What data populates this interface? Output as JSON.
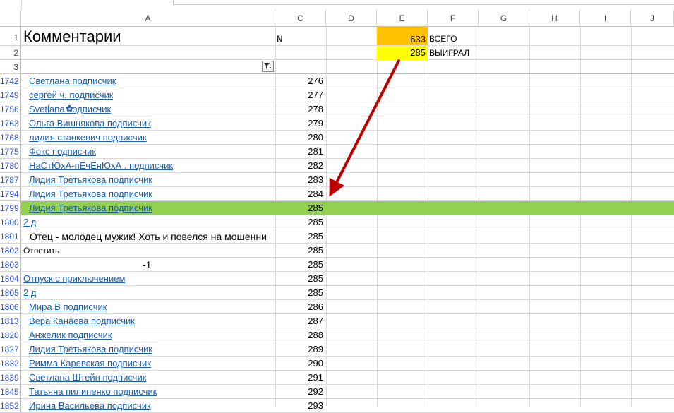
{
  "columns": [
    "A",
    "C",
    "D",
    "E",
    "F",
    "G",
    "H",
    "I",
    "J"
  ],
  "header": {
    "title": "Комментарии",
    "n_label": "N",
    "total_value": "633",
    "total_label": "ВСЕГО",
    "won_value": "285",
    "won_label": "ВЫИГРАЛ"
  },
  "header_rows": [
    "1",
    "2",
    "3"
  ],
  "rows": [
    {
      "num": "1742",
      "a": "Светлана подписчик",
      "c": "276",
      "link": true
    },
    {
      "num": "1749",
      "a": "сергей ч. подписчик",
      "c": "277",
      "link": true
    },
    {
      "num": "1756",
      "a": "Svetlana   подписчик",
      "c": "278",
      "link": true
    },
    {
      "num": "1763",
      "a": "Ольга Вишнякова подписчик",
      "c": "279",
      "link": true
    },
    {
      "num": "1768",
      "a": "лидия станкевич подписчик",
      "c": "280",
      "link": true
    },
    {
      "num": "1775",
      "a": "Фокс подписчик",
      "c": "281",
      "link": true
    },
    {
      "num": "1780",
      "a": "НаСтЮхА-пЕчЕнЮхА . подписчик",
      "c": "282",
      "link": true
    },
    {
      "num": "1787",
      "a": "Лидия Третьякова подписчик",
      "c": "283",
      "link": true
    },
    {
      "num": "1794",
      "a": "Лидия Третьякова подписчик",
      "c": "284",
      "link": true
    },
    {
      "num": "1799",
      "a": "Лидия Третьякова подписчик",
      "c": "285",
      "link": true
    },
    {
      "num": "1800",
      "a": "2 д",
      "c": "285",
      "link": true
    },
    {
      "num": "1801",
      "a": "Отец - молодец мужик! Хоть и повелся на мошенни",
      "c": "285",
      "link": false
    },
    {
      "num": "1802",
      "a": "Ответить",
      "c": "285",
      "link": false
    },
    {
      "num": "1803",
      "a": "-1",
      "c": "285",
      "link": false
    },
    {
      "num": "1804",
      "a": "Отпуск с приключением",
      "c": "285",
      "link": true
    },
    {
      "num": "1805",
      "a": "2 д",
      "c": "285",
      "link": true
    },
    {
      "num": "1806",
      "a": "Мира В подписчик",
      "c": "286",
      "link": true
    },
    {
      "num": "1813",
      "a": "Вера Канаева подписчик",
      "c": "287",
      "link": true
    },
    {
      "num": "1820",
      "a": "Анжелик подписчик",
      "c": "288",
      "link": true
    },
    {
      "num": "1827",
      "a": "Лидия Третьякова подписчик",
      "c": "289",
      "link": true
    },
    {
      "num": "1832",
      "a": "Римма Каревская подписчик",
      "c": "290",
      "link": true
    },
    {
      "num": "1839",
      "a": "Светлана Штейн подписчик",
      "c": "291",
      "link": true
    },
    {
      "num": "1845",
      "a": "Татьяна пилипенко подписчик",
      "c": "292",
      "link": true
    },
    {
      "num": "1852",
      "a": "Ирина Васильева подписчик",
      "c": "293",
      "link": true
    }
  ],
  "colors": {
    "highlight_row": "#92d050",
    "total_cell": "#ffc000",
    "won_cell": "#ffff00",
    "arrow": "#c00000"
  }
}
